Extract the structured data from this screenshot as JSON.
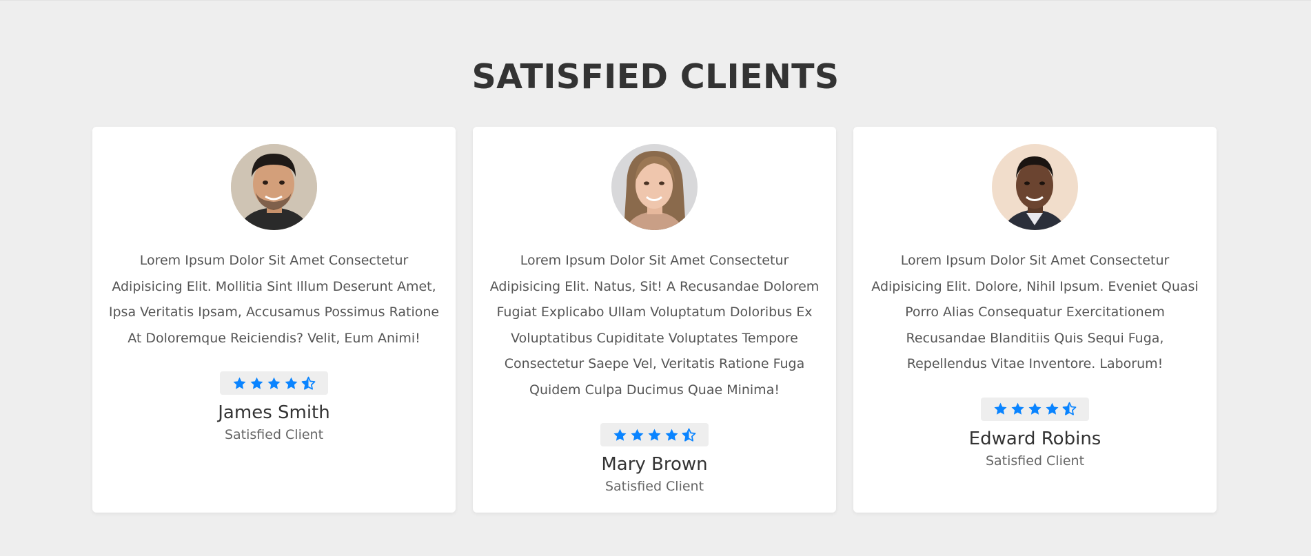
{
  "section": {
    "title": "SATISFIED CLIENTS"
  },
  "colors": {
    "background": "#eeeeee",
    "card": "#ffffff",
    "star": "#0a84ff"
  },
  "testimonials": [
    {
      "quote": "Lorem Ipsum Dolor Sit Amet Consectetur Adipisicing Elit. Mollitia Sint Illum Deserunt Amet, Ipsa Veritatis Ipsam, Accusamus Possimus Ratione At Doloremque Reiciendis? Velit, Eum Animi!",
      "rating": 4.5,
      "name": "James Smith",
      "role": "Satisfied Client"
    },
    {
      "quote": "Lorem Ipsum Dolor Sit Amet Consectetur Adipisicing Elit. Natus, Sit! A Recusandae Dolorem Fugiat Explicabo Ullam Voluptatum Doloribus Ex Voluptatibus Cupiditate Voluptates Tempore Consectetur Saepe Vel, Veritatis Ratione Fuga Quidem Culpa Ducimus Quae Minima!",
      "rating": 4.5,
      "name": "Mary Brown",
      "role": "Satisfied Client"
    },
    {
      "quote": "Lorem Ipsum Dolor Sit Amet Consectetur Adipisicing Elit. Dolore, Nihil Ipsum. Eveniet Quasi Porro Alias Consequatur Exercitationem Recusandae Blanditiis Quis Sequi Fuga, Repellendus Vitae Inventore. Laborum!",
      "rating": 4.5,
      "name": "Edward Robins",
      "role": "Satisfied Client"
    }
  ]
}
